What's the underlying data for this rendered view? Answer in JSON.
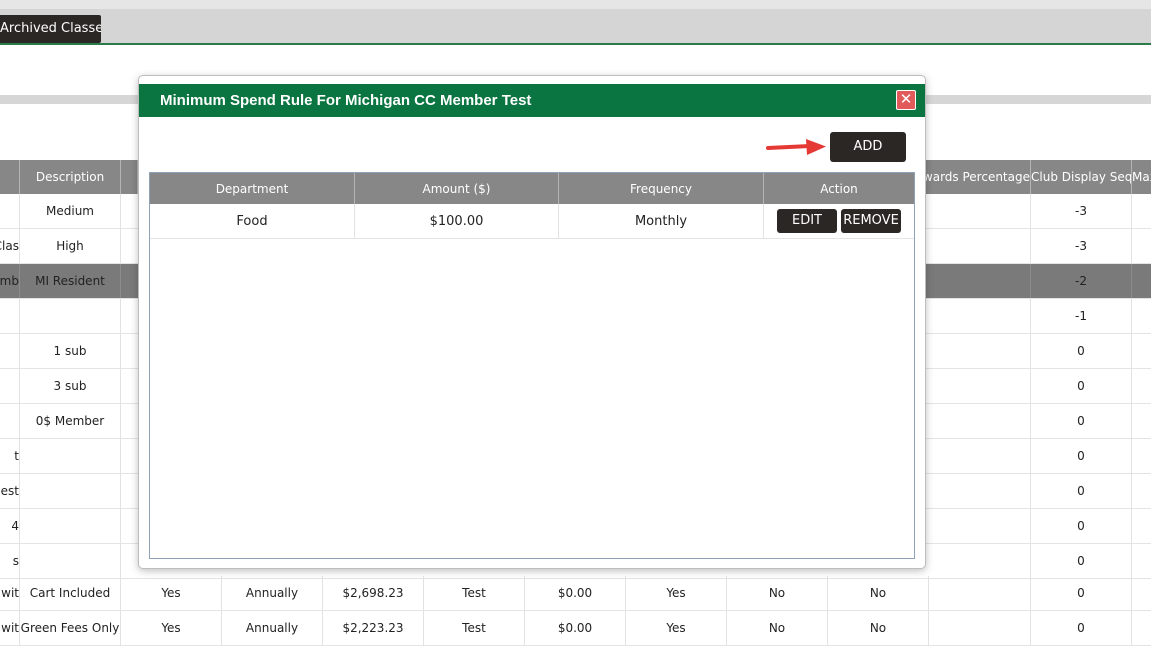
{
  "tabs": {
    "active_label": "Archived Classes"
  },
  "background_table": {
    "headers": [
      {
        "name": "col-a",
        "text": ""
      },
      {
        "name": "col-description",
        "text": "Description"
      },
      {
        "name": "col-awards-percentage",
        "text": "s Awards Percentage"
      },
      {
        "name": "col-club-display-sequence",
        "text": "Club Display Seque"
      },
      {
        "name": "col-max",
        "text": "Max"
      }
    ],
    "rows": [
      {
        "a": "",
        "description": "Medium",
        "seq": "-3"
      },
      {
        "a": "Clas",
        "description": "High",
        "seq": "-3"
      },
      {
        "a": "emb",
        "description": "MI Resident",
        "seq": "-2"
      },
      {
        "a": "",
        "description": "",
        "seq": "-1"
      },
      {
        "a": "",
        "description": "1 sub",
        "seq": "0"
      },
      {
        "a": "",
        "description": "3 sub",
        "seq": "0"
      },
      {
        "a": "",
        "description": "0$ Member",
        "seq": "0"
      },
      {
        "a": "t",
        "description": "",
        "seq": "0"
      },
      {
        "a": "est",
        "description": "",
        "seq": "0"
      },
      {
        "a": "4",
        "description": "",
        "seq": "0"
      },
      {
        "a": "s",
        "description": "",
        "seq": "0"
      },
      {
        "a": "e wit",
        "description": "Cart Included",
        "c3": "Yes",
        "c4": "Annually",
        "c5": "$2,698.23",
        "c6": "Test",
        "c7": "$0.00",
        "c8": "Yes",
        "c9": "No",
        "c10": "No",
        "seq": "0"
      },
      {
        "a": "e wit",
        "description": "Green Fees Only",
        "c3": "Yes",
        "c4": "Annually",
        "c5": "$2,223.23",
        "c6": "Test",
        "c7": "$0.00",
        "c8": "Yes",
        "c9": "No",
        "c10": "No",
        "seq": "0"
      }
    ]
  },
  "modal": {
    "title": "Minimum Spend Rule For Michigan CC Member Test",
    "close_glyph": "✕",
    "add_label": "ADD",
    "columns": [
      "Department",
      "Amount ($)",
      "Frequency",
      "Action"
    ],
    "rows": [
      {
        "department": "Food",
        "amount": "$100.00",
        "frequency": "Monthly",
        "edit_label": "EDIT",
        "remove_label": "REMOVE"
      }
    ]
  },
  "colors": {
    "header_green": "#0a7541",
    "grid_header_grey": "#878787",
    "button_dark": "#2b2725",
    "close_red": "#e25b5b",
    "arrow_red": "#e53935"
  },
  "icons": {
    "close": "close-icon",
    "arrow": "arrow-right-icon"
  }
}
